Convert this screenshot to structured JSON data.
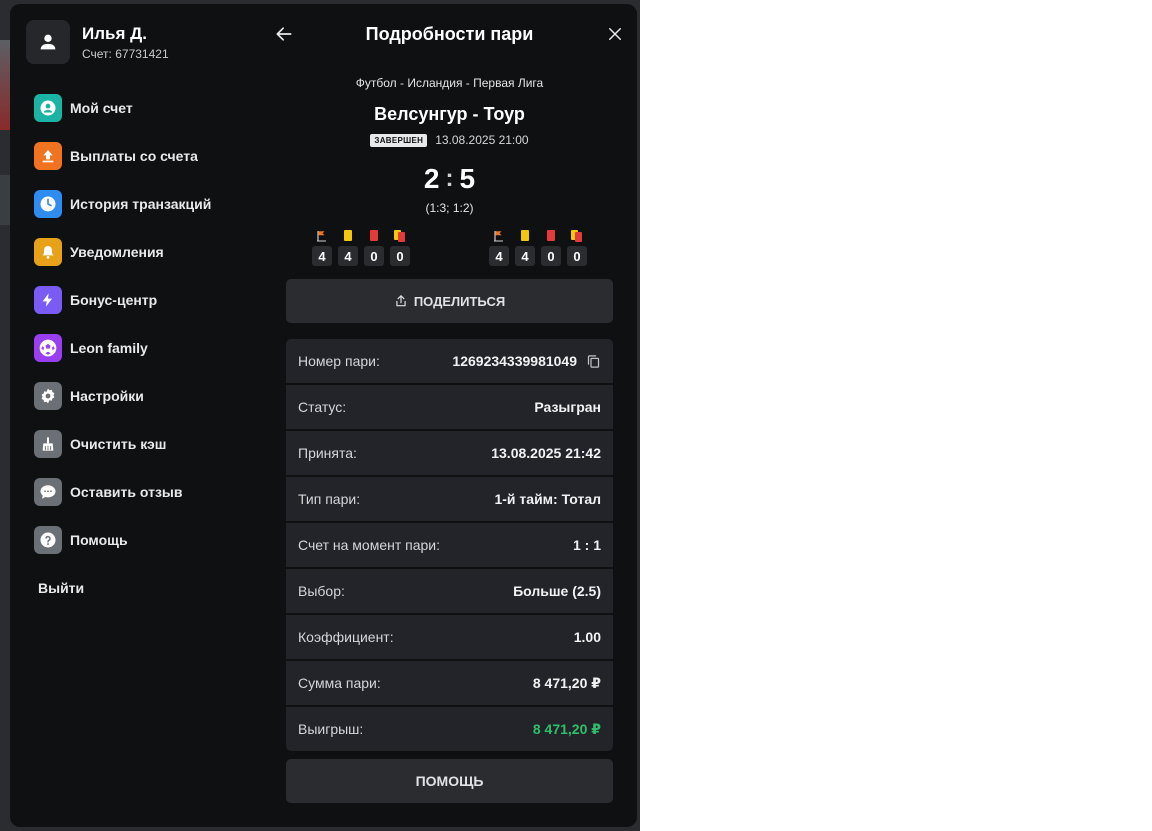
{
  "profile": {
    "name": "Илья Д.",
    "account_label": "Счет:",
    "account_number": "67731421"
  },
  "menu": {
    "items": [
      {
        "label": "Мой счет",
        "icon": "user-circle-icon",
        "color": "#1bb3a3"
      },
      {
        "label": "Выплаты со счета",
        "icon": "upload-icon",
        "color": "#f0731f"
      },
      {
        "label": "История транзакций",
        "icon": "clock-icon",
        "color": "#2f8cf0"
      },
      {
        "label": "Уведомления",
        "icon": "bell-icon",
        "color": "#e8a21a"
      },
      {
        "label": "Бонус-центр",
        "icon": "lightning-icon",
        "color": "#7a5cf5"
      },
      {
        "label": "Leon family",
        "icon": "ball-icon",
        "color": "#9a3ff0"
      },
      {
        "label": "Настройки",
        "icon": "gear-icon",
        "color": "#6b6f76"
      },
      {
        "label": "Очистить кэш",
        "icon": "broom-icon",
        "color": "#6b6f76"
      },
      {
        "label": "Оставить отзыв",
        "icon": "chat-icon",
        "color": "#6b6f76"
      },
      {
        "label": "Помощь",
        "icon": "question-icon",
        "color": "#6b6f76"
      }
    ],
    "logout": "Выйти"
  },
  "details": {
    "title": "Подробности пари",
    "league": "Футбол - Исландия - Первая Лига",
    "match": "Велсунгур - Тоур",
    "status_badge": "ЗАВЕРШЕН",
    "date": "13.08.2025 21:00",
    "score": {
      "home": "2",
      "sep": ":",
      "away": "5"
    },
    "half_scores": "(1:3; 1:2)",
    "stats": {
      "home": {
        "corners": "4",
        "yellow": "4",
        "red": "0",
        "yellow_red": "0"
      },
      "away": {
        "corners": "4",
        "yellow": "4",
        "red": "0",
        "yellow_red": "0"
      }
    },
    "share_label": "ПОДЕЛИТЬСЯ",
    "rows": [
      {
        "label": "Номер пари:",
        "value": "1269234339981049"
      },
      {
        "label": "Статус:",
        "value": "Разыгран"
      },
      {
        "label": "Принята:",
        "value": "13.08.2025 21:42"
      },
      {
        "label": "Тип пари:",
        "value": "1-й тайм: Тотал"
      },
      {
        "label": "Счет на момент пари:",
        "value": "1 : 1"
      },
      {
        "label": "Выбор:",
        "value": "Больше (2.5)"
      },
      {
        "label": "Коэффициент:",
        "value": "1.00"
      },
      {
        "label": "Сумма пари:",
        "value": "8 471,20 ₽"
      },
      {
        "label": "Выигрыш:",
        "value": "8 471,20 ₽"
      }
    ],
    "help_label": "ПОМОЩЬ"
  },
  "colors": {
    "win": "#2fbf6a",
    "panel": "#0f1012",
    "row": "#22242a"
  }
}
